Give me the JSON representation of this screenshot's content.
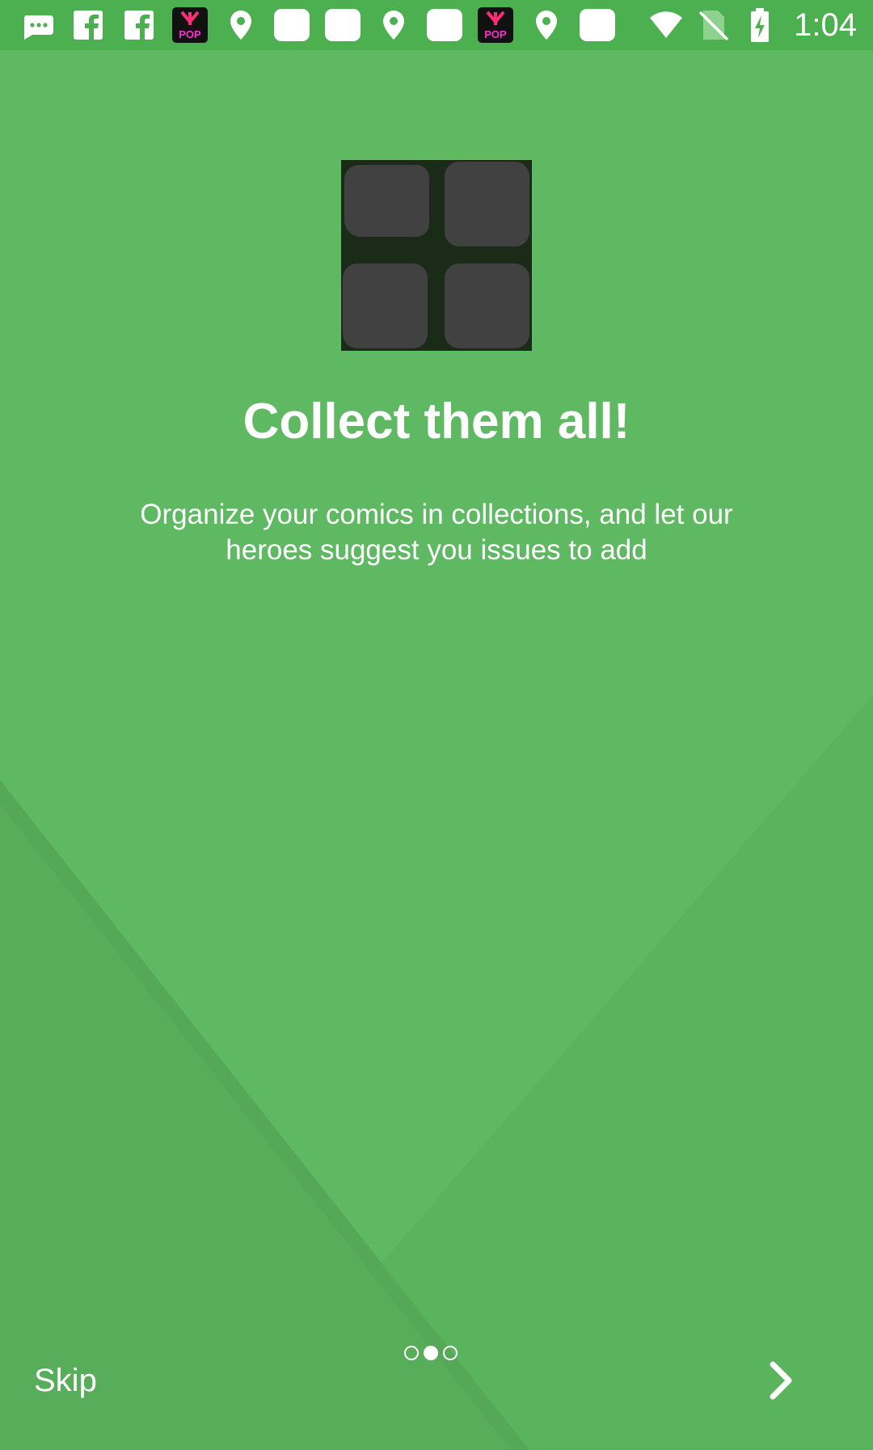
{
  "status_bar": {
    "notification_icons": [
      "messages-icon",
      "facebook-icon",
      "facebook-icon",
      "kpop-app-icon",
      "location-pin-icon",
      "blank-app-icon",
      "blank-app-icon",
      "location-pin-icon",
      "blank-app-icon",
      "kpop-app-icon",
      "location-pin-icon",
      "blank-app-icon"
    ],
    "system_icons": [
      "wifi-icon",
      "no-sim-icon",
      "battery-charging-icon"
    ],
    "time": "1:04"
  },
  "onboarding": {
    "title": "Collect them all!",
    "description": "Organize your comics in collections, and let our heroes suggest you issues to add",
    "page_index": 1,
    "page_count": 3
  },
  "controls": {
    "skip_label": "Skip",
    "next_icon": "chevron-right-icon"
  },
  "colors": {
    "background": "#5fb862",
    "status_bar": "#4caf50",
    "image_background": "#1a2b18",
    "tile": "#414141",
    "text": "#ffffff"
  }
}
